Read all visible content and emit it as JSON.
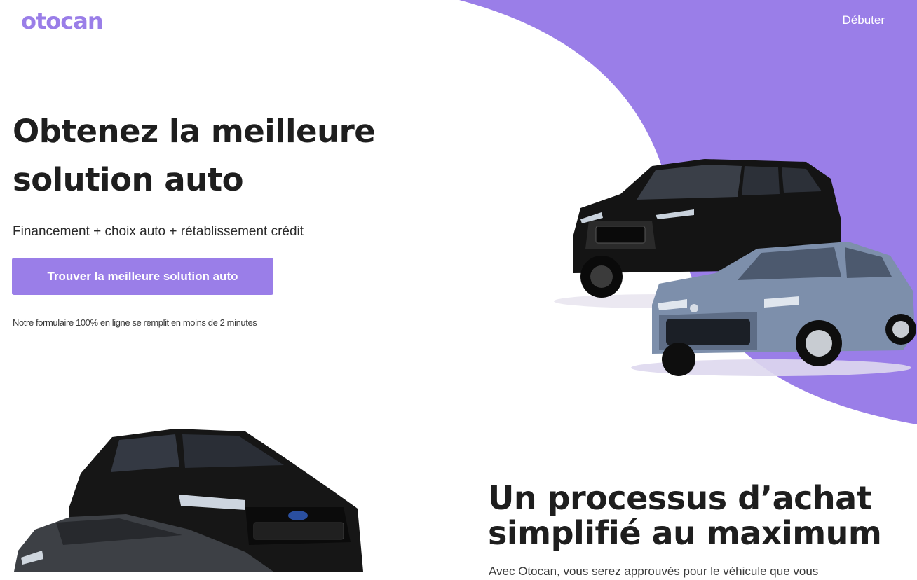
{
  "header": {
    "logo_text": "otocan",
    "nav_cta_label": "Débuter"
  },
  "hero": {
    "title_line_1": "Obtenez la meilleure",
    "title_line_2": "solution auto",
    "subtitle": "Financement + choix auto + rétablissement crédit",
    "cta_label": "Trouver la meilleure solution auto",
    "note": "Notre formulaire 100% en ligne se remplit en moins de 2 minutes"
  },
  "process_section": {
    "title_line_1": "Un processus d’achat",
    "title_line_2": "simplifié au maximum",
    "body_partial": "Avec Otocan, vous serez approuvés pour le véhicule que vous"
  },
  "colors": {
    "brand_purple": "#9a7ee8",
    "text_dark": "#1e1e1e",
    "white": "#ffffff"
  }
}
